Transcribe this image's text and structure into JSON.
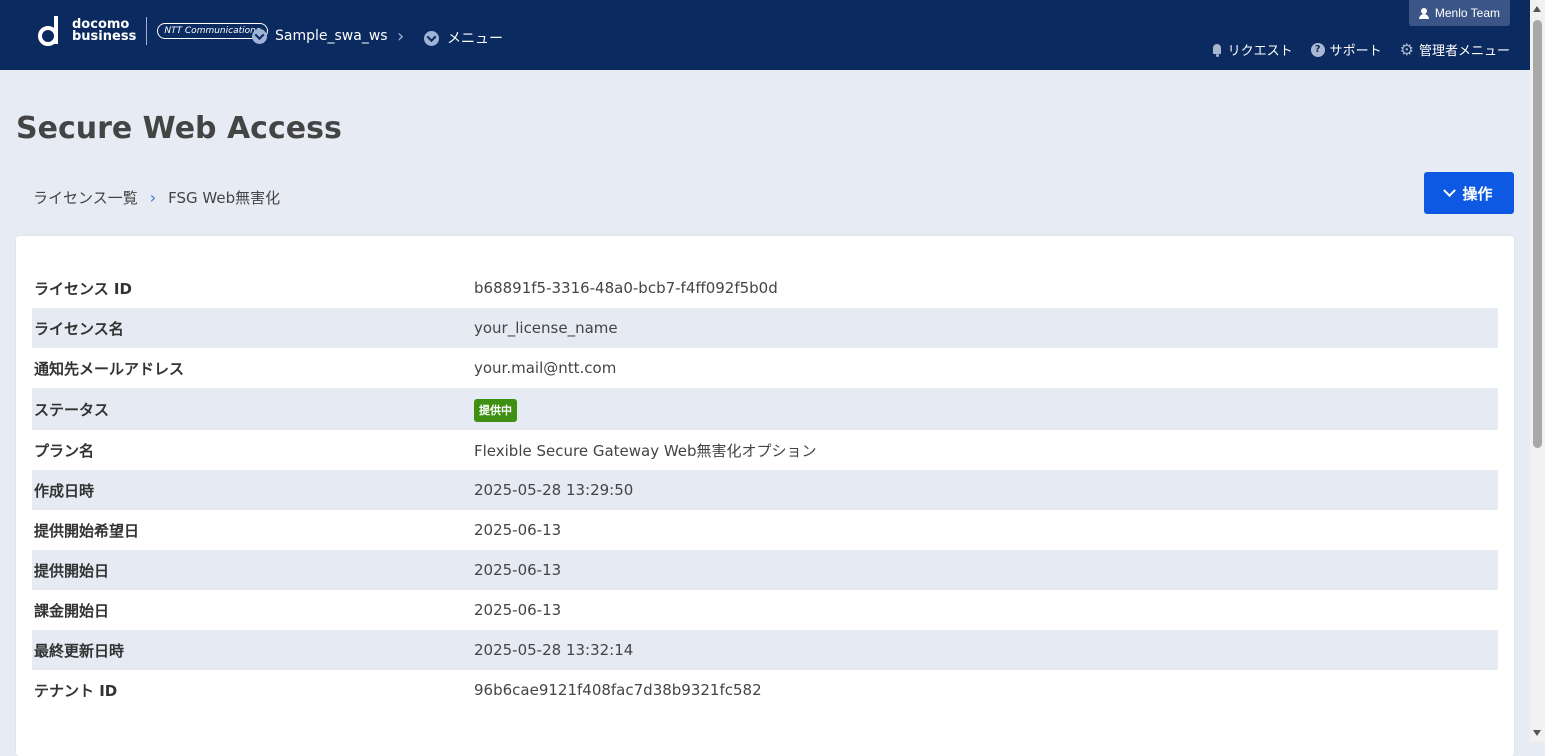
{
  "header": {
    "logo_docomo": "docomo",
    "logo_business": "business",
    "logo_ntt": "NTT Communications",
    "workspace": "Sample_swa_ws",
    "menu": "メニュー",
    "user": "Menlo Team",
    "links": {
      "request": "リクエスト",
      "support": "サポート",
      "admin_menu": "管理者メニュー"
    }
  },
  "page": {
    "title": "Secure Web Access",
    "breadcrumb": {
      "parent": "ライセンス一覧",
      "current": "FSG Web無害化"
    },
    "action_label": "操作"
  },
  "details": [
    {
      "label": "ライセンス ID",
      "value": "b68891f5-3316-48a0-bcb7-f4ff092f5b0d"
    },
    {
      "label": "ライセンス名",
      "value": "your_license_name"
    },
    {
      "label": "通知先メールアドレス",
      "value": "your.mail@ntt.com"
    },
    {
      "label": "ステータス",
      "value": "提供中",
      "status_color": "#3f8f12"
    },
    {
      "label": "プラン名",
      "value": "Flexible Secure Gateway Web無害化オプション"
    },
    {
      "label": "作成日時",
      "value": "2025-05-28 13:29:50"
    },
    {
      "label": "提供開始希望日",
      "value": "2025-06-13"
    },
    {
      "label": "提供開始日",
      "value": "2025-06-13"
    },
    {
      "label": "課金開始日",
      "value": "2025-06-13"
    },
    {
      "label": "最終更新日時",
      "value": "2025-05-28 13:32:14"
    },
    {
      "label": "テナント ID",
      "value": "96b6cae9121f408fac7d38b9321fc582"
    }
  ],
  "colors": {
    "header_bg": "#0b2a5f",
    "page_bg": "#e7ebf3",
    "accent": "#0d59e3",
    "status_active": "#3f8f12"
  }
}
